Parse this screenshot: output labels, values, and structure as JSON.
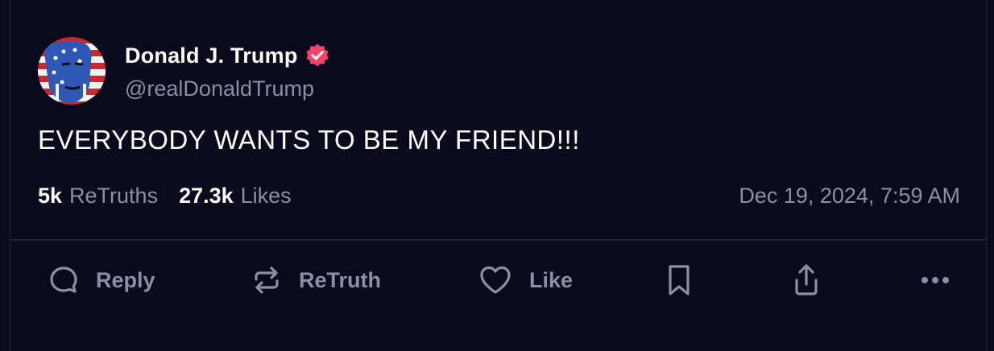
{
  "author": {
    "name": "Donald J. Trump",
    "handle": "@realDonaldTrump"
  },
  "post": {
    "text": "EVERYBODY WANTS TO BE MY FRIEND!!!",
    "timestamp": "Dec 19, 2024, 7:59 AM"
  },
  "stats": {
    "retruths_count": "5k",
    "retruths_label": "ReTruths",
    "likes_count": "27.3k",
    "likes_label": "Likes"
  },
  "actions": {
    "reply": "Reply",
    "retruth": "ReTruth",
    "like": "Like"
  },
  "colors": {
    "background": "#0b0a1c",
    "verified_badge": "#f0456a",
    "muted_text": "#8f8da3",
    "divider": "#26243d"
  },
  "icons": [
    "reply-icon",
    "retruth-icon",
    "heart-icon",
    "bookmark-icon",
    "share-icon",
    "more-icon",
    "verified-icon"
  ]
}
